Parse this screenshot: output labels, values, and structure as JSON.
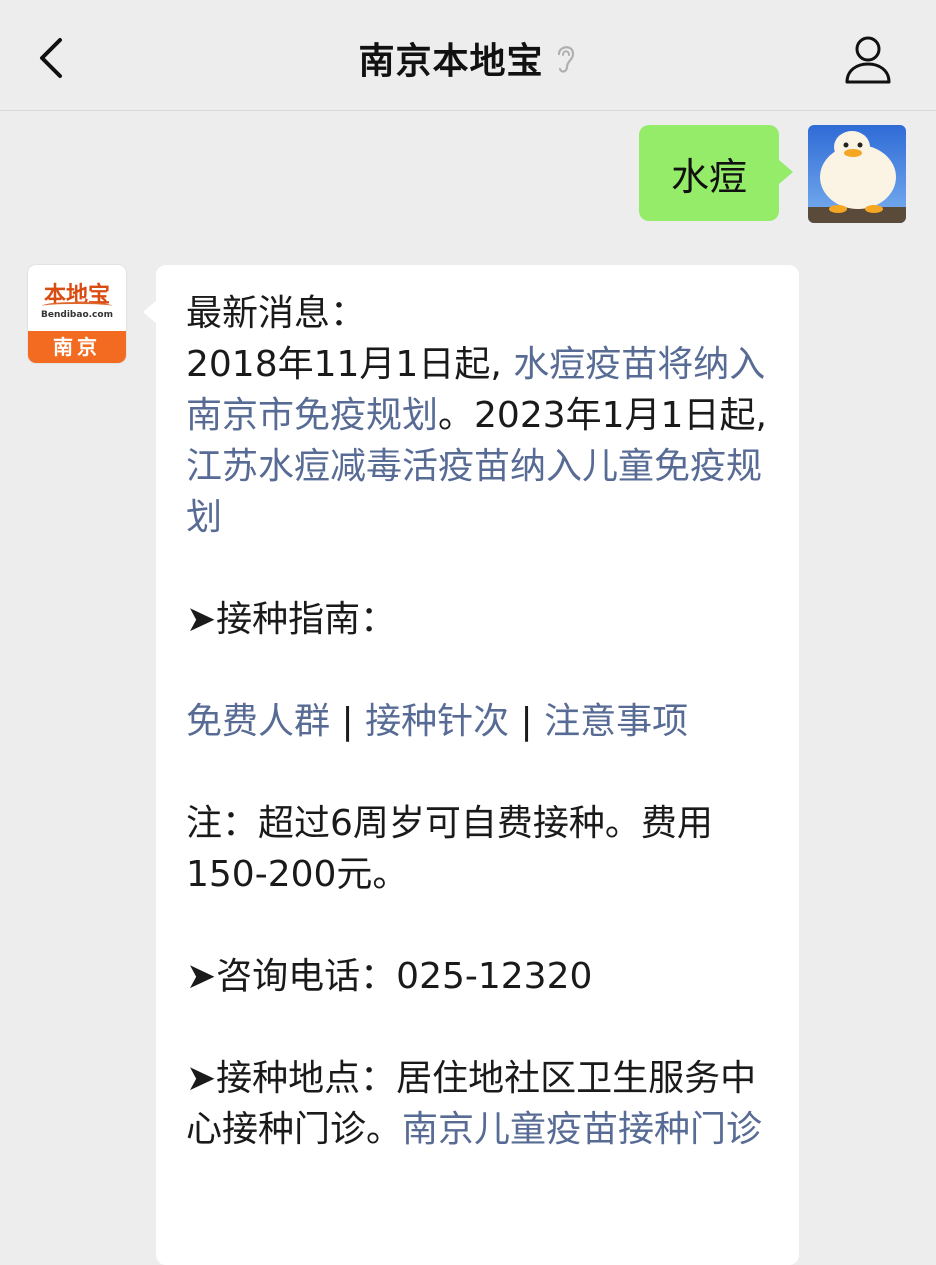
{
  "header": {
    "title": "南京本地宝",
    "back_icon": "chevron-left-icon",
    "mute_icon": "ear-icon",
    "profile_icon": "person-icon"
  },
  "outgoing": {
    "text": "水痘"
  },
  "bot": {
    "avatar": {
      "logo_text": "本地宝",
      "domain": "Bendibao.com",
      "city": "南京"
    },
    "line1": "最新消息：",
    "line2_a": "2018年11月1日起, ",
    "line2_link": "水痘疫苗将纳入南京市免疫规划",
    "line2_b": "。2023年1月1日起, ",
    "line2_link2": "江苏水痘减毒活疫苗纳入儿童免疫规划",
    "guide_title": "➤接种指南：",
    "links": [
      "免费人群",
      "接种针次",
      "注意事项"
    ],
    "separator": "|",
    "note": "注：超过6周岁可自费接种。费用150-200元。",
    "phone": "➤咨询电话：025-12320",
    "place_a": "➤接种地点：居住地社区卫生服务中心接种门诊。",
    "place_link": "南京儿童疫苗接种门诊"
  },
  "colors": {
    "background": "#ededed",
    "outgoing_bubble": "#95ec69",
    "incoming_bubble": "#ffffff",
    "link": "#576b95",
    "brand_orange": "#f26b21"
  }
}
